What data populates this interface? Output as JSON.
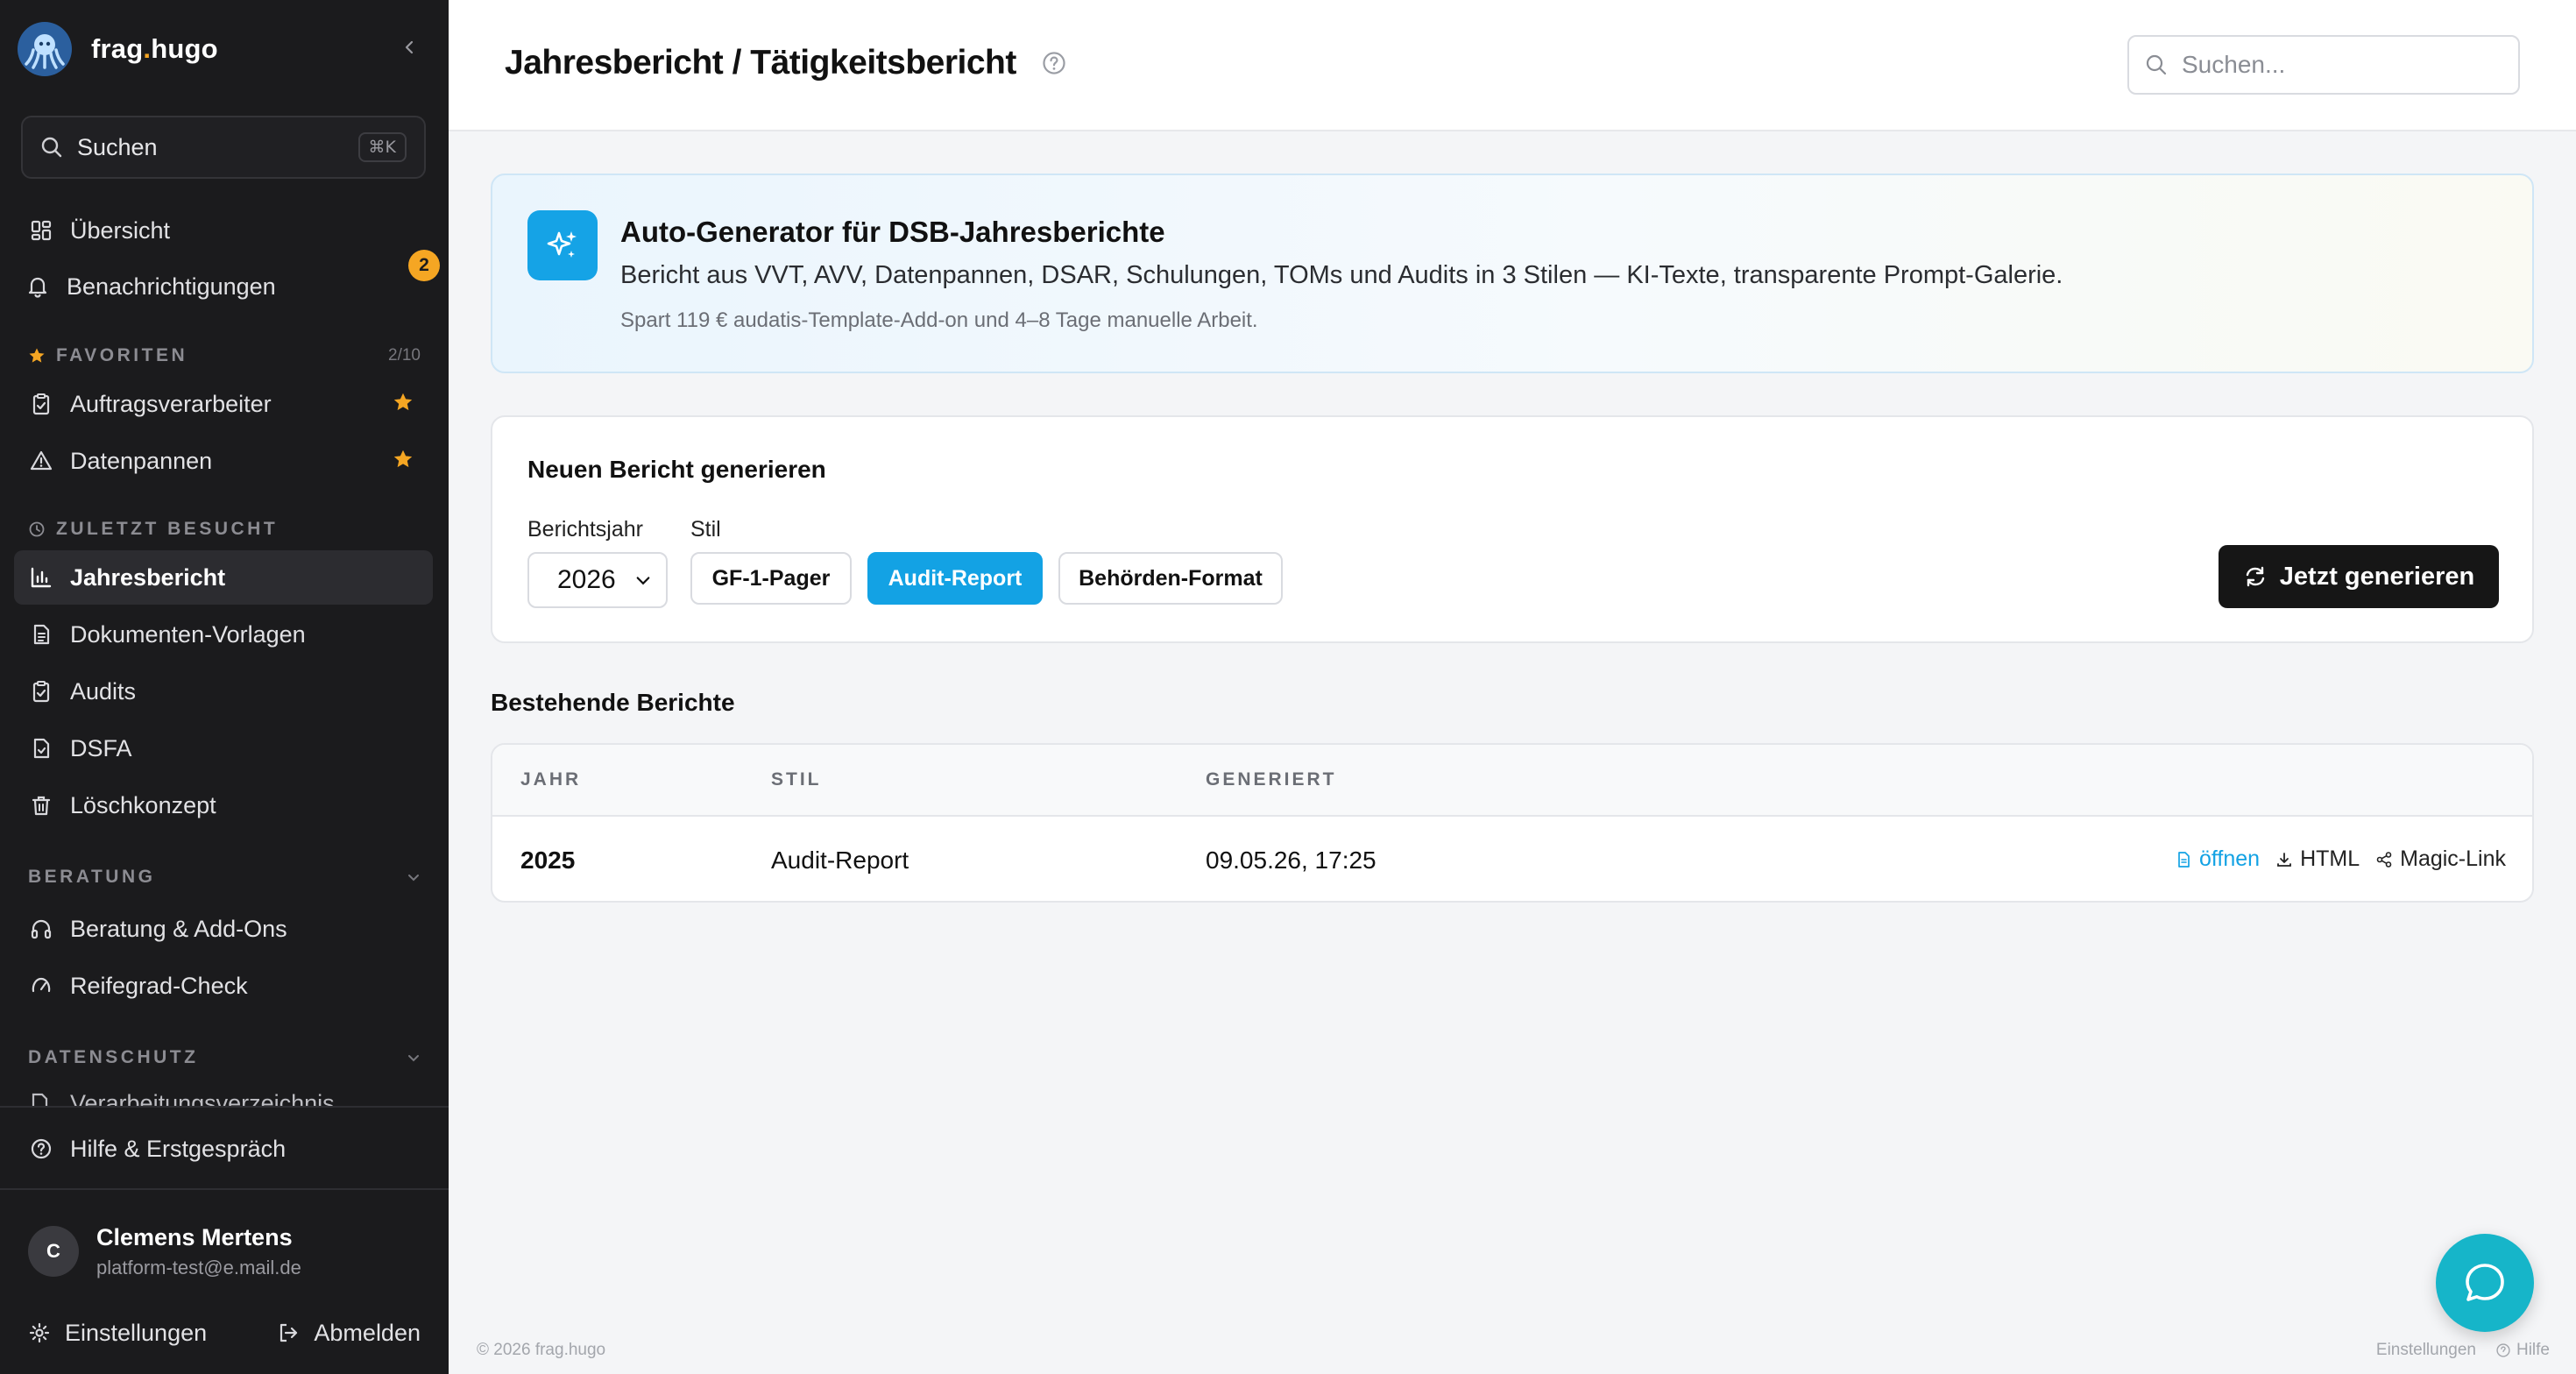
{
  "brand": {
    "name_prefix": "frag",
    "name_dot": ".",
    "name_suffix": "hugo"
  },
  "sidebar": {
    "search": {
      "label": "Suchen",
      "shortcut": "⌘K"
    },
    "top_items": [
      {
        "label": "Übersicht",
        "icon": "dashboard-icon"
      },
      {
        "label": "Benachrichtigungen",
        "icon": "bell-icon",
        "badge": "2"
      }
    ],
    "favorites": {
      "title": "FAVORITEN",
      "count": "2/10",
      "items": [
        {
          "label": "Auftragsverarbeiter",
          "icon": "clipboard-check-icon"
        },
        {
          "label": "Datenpannen",
          "icon": "warning-icon"
        }
      ]
    },
    "recent": {
      "title": "ZULETZT BESUCHT",
      "items": [
        {
          "label": "Jahresbericht",
          "icon": "bar-chart-icon",
          "active": true
        },
        {
          "label": "Dokumenten-Vorlagen",
          "icon": "document-icon"
        },
        {
          "label": "Audits",
          "icon": "clipboard-check-icon"
        },
        {
          "label": "DSFA",
          "icon": "file-check-icon"
        },
        {
          "label": "Löschkonzept",
          "icon": "trash-icon"
        }
      ]
    },
    "beratung": {
      "title": "BERATUNG",
      "items": [
        {
          "label": "Beratung & Add-Ons",
          "icon": "headphones-icon"
        },
        {
          "label": "Reifegrad-Check",
          "icon": "gauge-icon"
        }
      ]
    },
    "datenschutz": {
      "title": "DATENSCHUTZ",
      "partial_item": "Verarbeitungsverzeichnis"
    },
    "help": {
      "label": "Hilfe & Erstgespräch"
    },
    "user": {
      "initial": "C",
      "name": "Clemens Mertens",
      "email": "platform-test@e.mail.de"
    },
    "settings_label": "Einstellungen",
    "logout_label": "Abmelden"
  },
  "header": {
    "title": "Jahresbericht / Tätigkeitsbericht",
    "search_placeholder": "Suchen..."
  },
  "hero": {
    "title": "Auto-Generator für DSB-Jahresberichte",
    "description": "Bericht aus VVT, AVV, Datenpannen, DSAR, Schulungen, TOMs und Audits in 3 Stilen — KI-Texte, transparente Prompt-Galerie.",
    "note": "Spart 119 € audatis-Template-Add-on und 4–8 Tage manuelle Arbeit."
  },
  "generator": {
    "title": "Neuen Bericht generieren",
    "year_label": "Berichtsjahr",
    "year_value": "2026",
    "style_label": "Stil",
    "styles": [
      "GF-1-Pager",
      "Audit-Report",
      "Behörden-Format"
    ],
    "selected_style": "Audit-Report",
    "generate_label": "Jetzt generieren"
  },
  "reports": {
    "title": "Bestehende Berichte",
    "columns": [
      "JAHR",
      "STIL",
      "GENERIERT"
    ],
    "rows": [
      {
        "year": "2025",
        "style": "Audit-Report",
        "generated": "09.05.26, 17:25"
      }
    ],
    "actions": {
      "open": "öffnen",
      "html": "HTML",
      "magic": "Magic-Link"
    }
  },
  "footer": {
    "copyright": "© 2026 frag.hugo",
    "settings": "Einstellungen",
    "help": "Hilfe"
  },
  "colors": {
    "sidebar_bg": "#1b1b1d",
    "accent_blue": "#13a2e4",
    "star_orange": "#f5a623",
    "chat_teal": "#16b5c9"
  }
}
